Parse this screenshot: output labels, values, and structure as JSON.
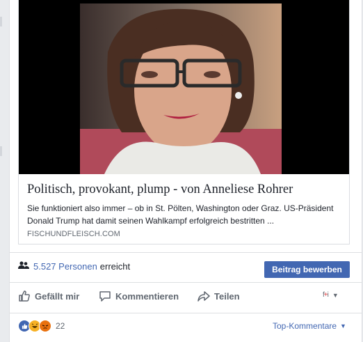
{
  "link_preview": {
    "title": "Politisch, provokant, plump - von Anneliese Rohrer",
    "description": "Sie funktioniert also immer – ob in St. Pölten, Washington oder Graz. US-Präsident Donald Trump hat damit seinen Wahlkampf erfolgreich bestritten ...",
    "source": "FISCHUNDFLEISCH.COM"
  },
  "reach": {
    "count_text": "5.527 Personen",
    "suffix_text": "erreicht"
  },
  "boost_button": {
    "label": "Beitrag bewerben"
  },
  "actions": {
    "like_label": "Gefällt mir",
    "comment_label": "Kommentieren",
    "share_label": "Teilen",
    "audience_icon": "fb-avatar-icon"
  },
  "reactions": {
    "count": "22",
    "icons": [
      "like-reaction-icon",
      "haha-reaction-icon",
      "angry-reaction-icon"
    ]
  },
  "comments_filter": {
    "label": "Top-Kommentare"
  },
  "colors": {
    "accent": "#4267b2",
    "muted": "#606770",
    "border": "#dddfe2"
  }
}
